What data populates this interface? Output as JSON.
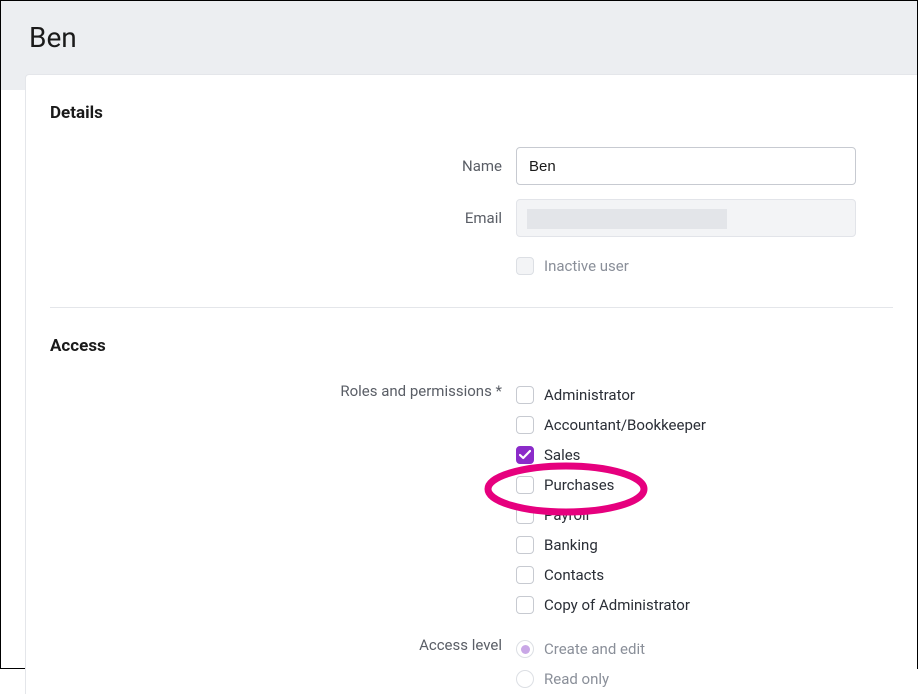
{
  "page": {
    "title": "Ben"
  },
  "details": {
    "section_title": "Details",
    "name_label": "Name",
    "name_value": "Ben",
    "email_label": "Email",
    "inactive_label": "Inactive user"
  },
  "access": {
    "section_title": "Access",
    "roles_label": "Roles and permissions *",
    "roles": [
      {
        "label": "Administrator",
        "checked": false
      },
      {
        "label": "Accountant/Bookkeeper",
        "checked": false
      },
      {
        "label": "Sales",
        "checked": true
      },
      {
        "label": "Purchases",
        "checked": false
      },
      {
        "label": "Payroll",
        "checked": false
      },
      {
        "label": "Banking",
        "checked": false
      },
      {
        "label": "Contacts",
        "checked": false
      },
      {
        "label": "Copy of Administrator",
        "checked": false
      }
    ],
    "level_label": "Access level",
    "levels": [
      {
        "label": "Create and edit",
        "selected": true
      },
      {
        "label": "Read only",
        "selected": false
      }
    ]
  },
  "colors": {
    "accent": "#8b2bc9",
    "annotation": "#e6007e"
  }
}
